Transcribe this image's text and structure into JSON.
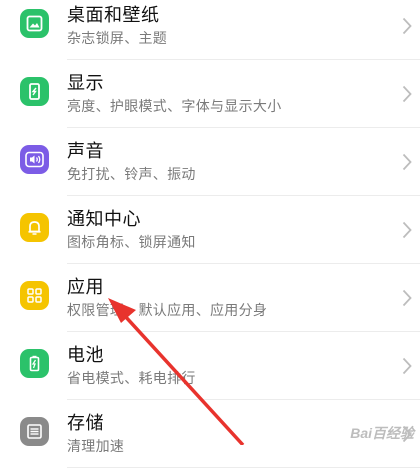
{
  "settings": {
    "items": [
      {
        "title": "桌面和壁纸",
        "subtitle": "杂志锁屏、主题",
        "icon": "wallpaper-icon",
        "color": "#2bc26a"
      },
      {
        "title": "显示",
        "subtitle": "亮度、护眼模式、字体与显示大小",
        "icon": "display-icon",
        "color": "#2bc26a"
      },
      {
        "title": "声音",
        "subtitle": "免打扰、铃声、振动",
        "icon": "sound-icon",
        "color": "#7c5ce6"
      },
      {
        "title": "通知中心",
        "subtitle": "图标角标、锁屏通知",
        "icon": "bell-icon",
        "color": "#f5c400"
      },
      {
        "title": "应用",
        "subtitle": "权限管理、默认应用、应用分身",
        "icon": "apps-icon",
        "color": "#f5c400"
      },
      {
        "title": "电池",
        "subtitle": "省电模式、耗电排行",
        "icon": "battery-icon",
        "color": "#2bc26a"
      },
      {
        "title": "存储",
        "subtitle": "清理加速",
        "icon": "storage-icon",
        "color": "#8a8a8a"
      }
    ]
  },
  "annotation": {
    "arrow_color": "#e8332d"
  },
  "watermark": {
    "text": "Bai百经验"
  }
}
